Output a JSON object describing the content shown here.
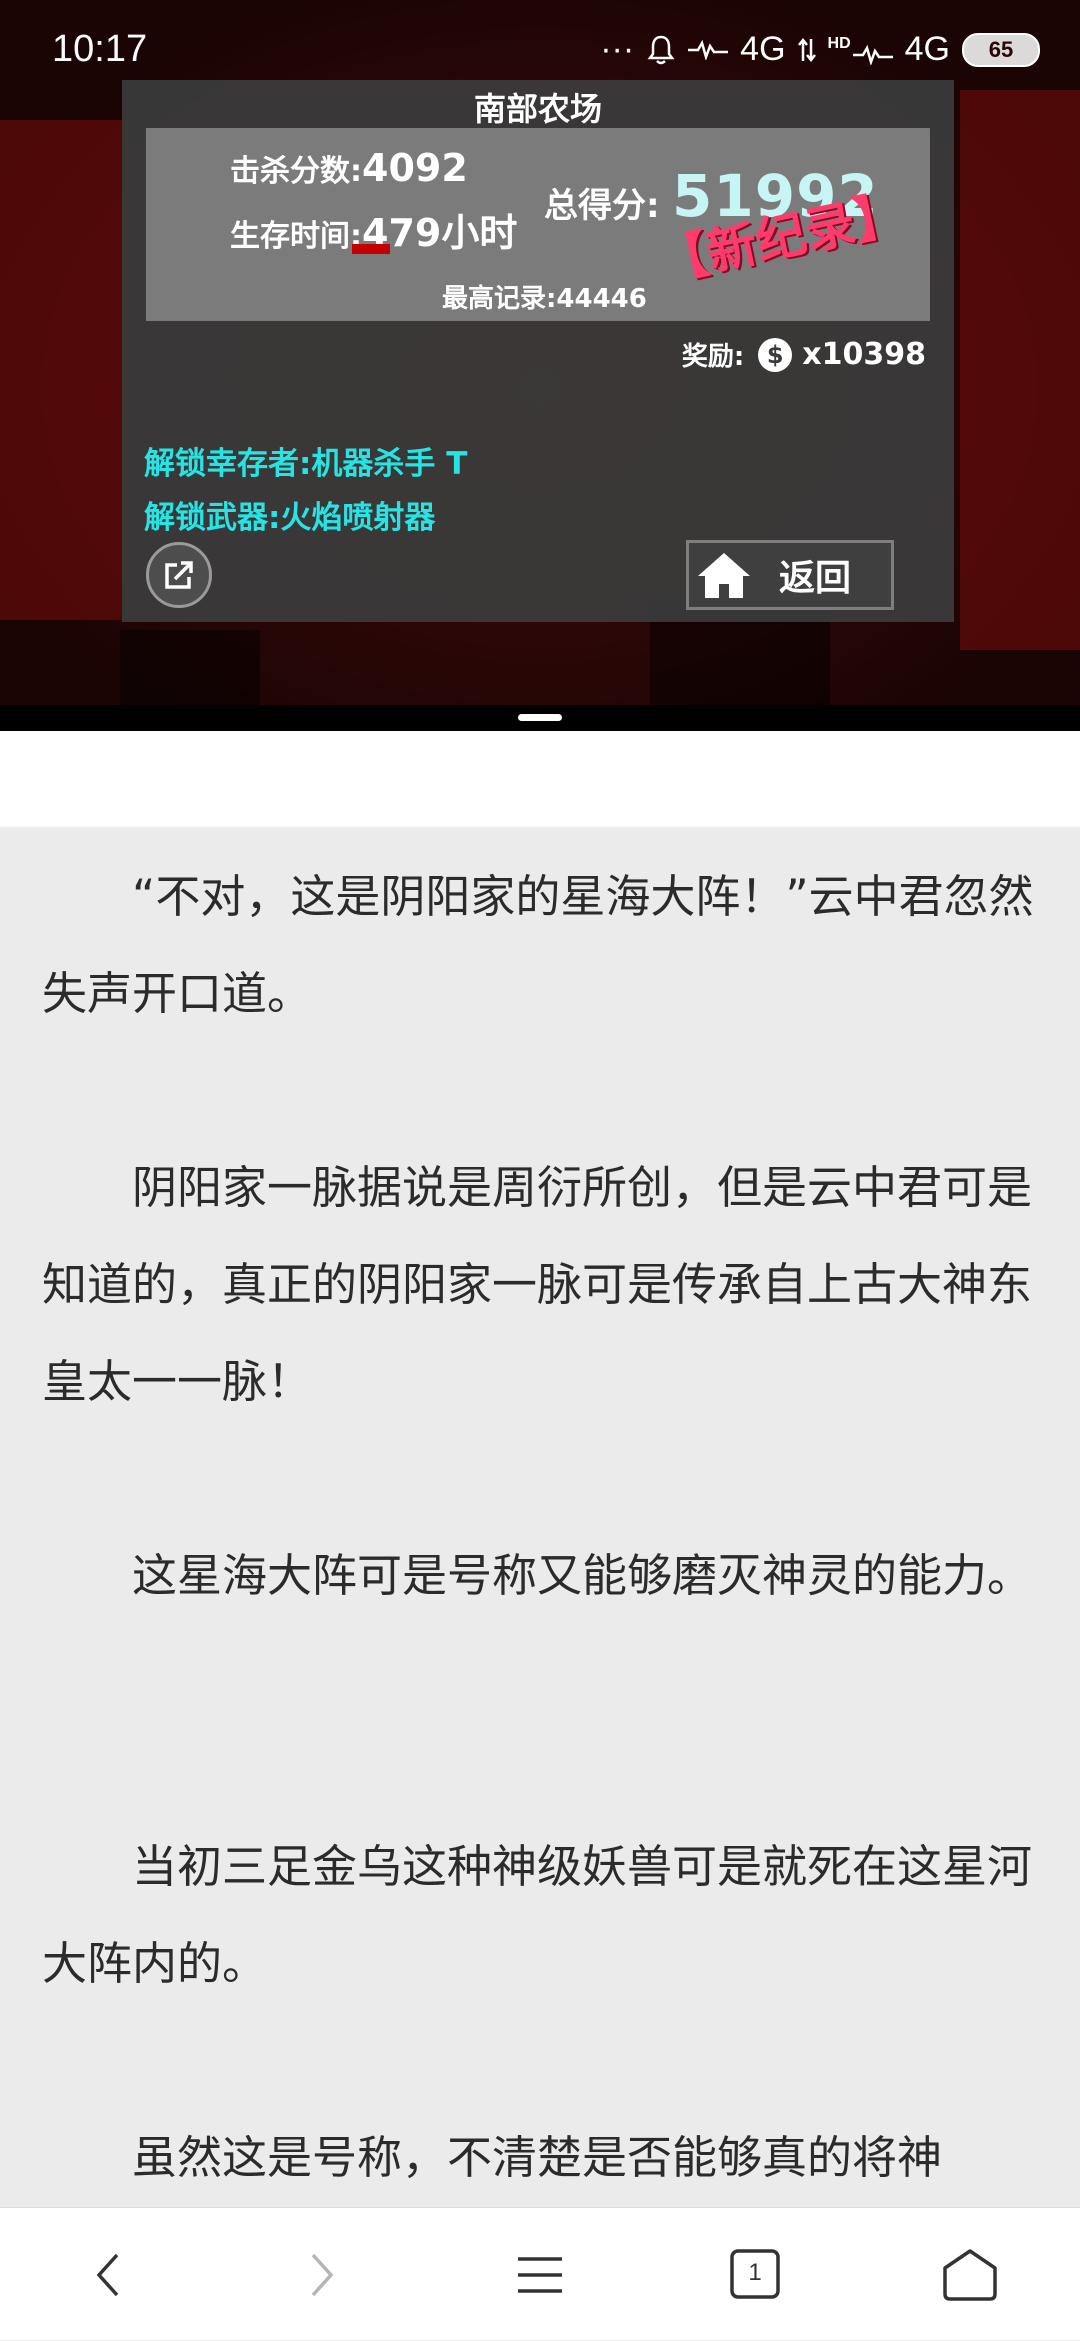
{
  "status_bar": {
    "time": "10:17",
    "dots": "···",
    "network_1": "4G",
    "network_2_prefix": "HD",
    "network_2": "4G",
    "battery": "65"
  },
  "game_result": {
    "title": "南部农场",
    "kills_label": "击杀分数:",
    "kills_value": "4092",
    "survival_label": "生存时间:",
    "survival_value": "479小时",
    "total_label": "总得分:",
    "total_value": "51992",
    "new_record": "【新纪录】",
    "best_record": "最高记录:44446",
    "reward_label": "奖励:",
    "reward_value": "x10398",
    "unlock_survivor": "解锁幸存者:机器杀手 T",
    "unlock_weapon": "解锁武器:火焰喷射器",
    "back_label": "返回"
  },
  "reader": {
    "paragraphs": [
      "“不对，这是阴阳家的星海大阵！”云中君忽然失声开口道。",
      "阴阳家一脉据说是周衍所创，但是云中君可是知道的，真正的阴阳家一脉可是传承自上古大神东皇太一一脉！",
      "这星海大阵可是号称又能够磨灭神灵的能力。",
      "当初三足金乌这种神级妖兽可是就死在这星河大阵内的。",
      "虽然这是号称，不清楚是否能够真的将神"
    ]
  },
  "bottom_nav": {
    "tab_count": "1"
  }
}
